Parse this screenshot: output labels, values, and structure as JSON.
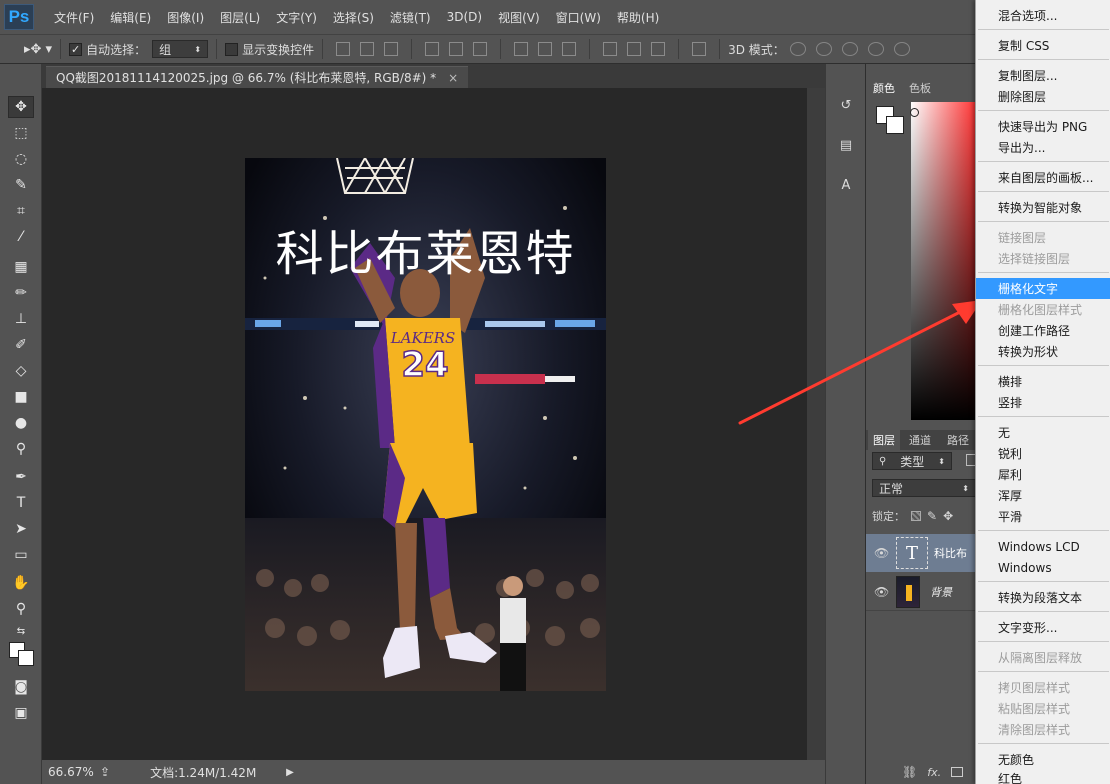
{
  "app": {
    "logo": "Ps"
  },
  "menubar": {
    "items": [
      "文件(F)",
      "编辑(E)",
      "图像(I)",
      "图层(L)",
      "文字(Y)",
      "选择(S)",
      "滤镜(T)",
      "3D(D)",
      "视图(V)",
      "窗口(W)",
      "帮助(H)"
    ]
  },
  "options": {
    "auto_select_label": "自动选择：",
    "auto_select_value": "组",
    "show_transform_label": "显示变换控件",
    "threed_mode_label": "3D 模式："
  },
  "document": {
    "tab_title": "QQ截图20181114120025.jpg @ 66.7% (科比布莱恩特, RGB/8#) *",
    "close_glyph": "×",
    "overlay_text": "科比布莱恩特",
    "jersey_text": "LAKERS",
    "jersey_number": "24"
  },
  "status": {
    "zoom": "66.67%",
    "doc_info": "文档:1.24M/1.42M"
  },
  "panels": {
    "color_tab": "颜色",
    "swatches_tab": "色板",
    "layers_tab": "图层",
    "channels_tab": "通道",
    "paths_tab": "路径",
    "kind_filter": "类型",
    "blend_mode": "正常",
    "lock_label": "锁定：",
    "layers": [
      {
        "name": "科比布",
        "type_glyph": "T"
      },
      {
        "name": "背景"
      }
    ],
    "fx_label": "fx."
  },
  "context_menu": {
    "items": [
      {
        "label": "混合选项...",
        "disabled": false
      },
      {
        "label": "复制 CSS",
        "disabled": false
      },
      {
        "label": "复制图层...",
        "disabled": false
      },
      {
        "label": "删除图层",
        "disabled": false
      },
      {
        "label": "快速导出为 PNG",
        "disabled": false
      },
      {
        "label": "导出为...",
        "disabled": false
      },
      {
        "label": "来自图层的画板...",
        "disabled": false
      },
      {
        "label": "转换为智能对象",
        "disabled": false
      },
      {
        "label": "链接图层",
        "disabled": true
      },
      {
        "label": "选择链接图层",
        "disabled": true
      },
      {
        "label": "栅格化文字",
        "disabled": false,
        "highlighted": true
      },
      {
        "label": "栅格化图层样式",
        "disabled": true
      },
      {
        "label": "创建工作路径",
        "disabled": false
      },
      {
        "label": "转换为形状",
        "disabled": false
      },
      {
        "label": "横排",
        "disabled": false
      },
      {
        "label": "竖排",
        "disabled": false
      },
      {
        "label": "无",
        "disabled": false
      },
      {
        "label": "锐利",
        "disabled": false
      },
      {
        "label": "犀利",
        "disabled": false
      },
      {
        "label": "浑厚",
        "disabled": false
      },
      {
        "label": "平滑",
        "disabled": false
      },
      {
        "label": "Windows LCD",
        "disabled": false
      },
      {
        "label": "Windows",
        "disabled": false
      },
      {
        "label": "转换为段落文本",
        "disabled": false
      },
      {
        "label": "文字变形...",
        "disabled": false
      },
      {
        "label": "从隔离图层释放",
        "disabled": true
      },
      {
        "label": "拷贝图层样式",
        "disabled": true
      },
      {
        "label": "粘贴图层样式",
        "disabled": true
      },
      {
        "label": "清除图层样式",
        "disabled": true
      },
      {
        "label": "无颜色",
        "disabled": false
      },
      {
        "label": "红色",
        "disabled": false
      }
    ]
  },
  "colors": {
    "highlight": "#3399ff",
    "arrow": "#ff3b2f",
    "jersey_yellow": "#f5b320",
    "jersey_purple": "#5b2a86"
  }
}
